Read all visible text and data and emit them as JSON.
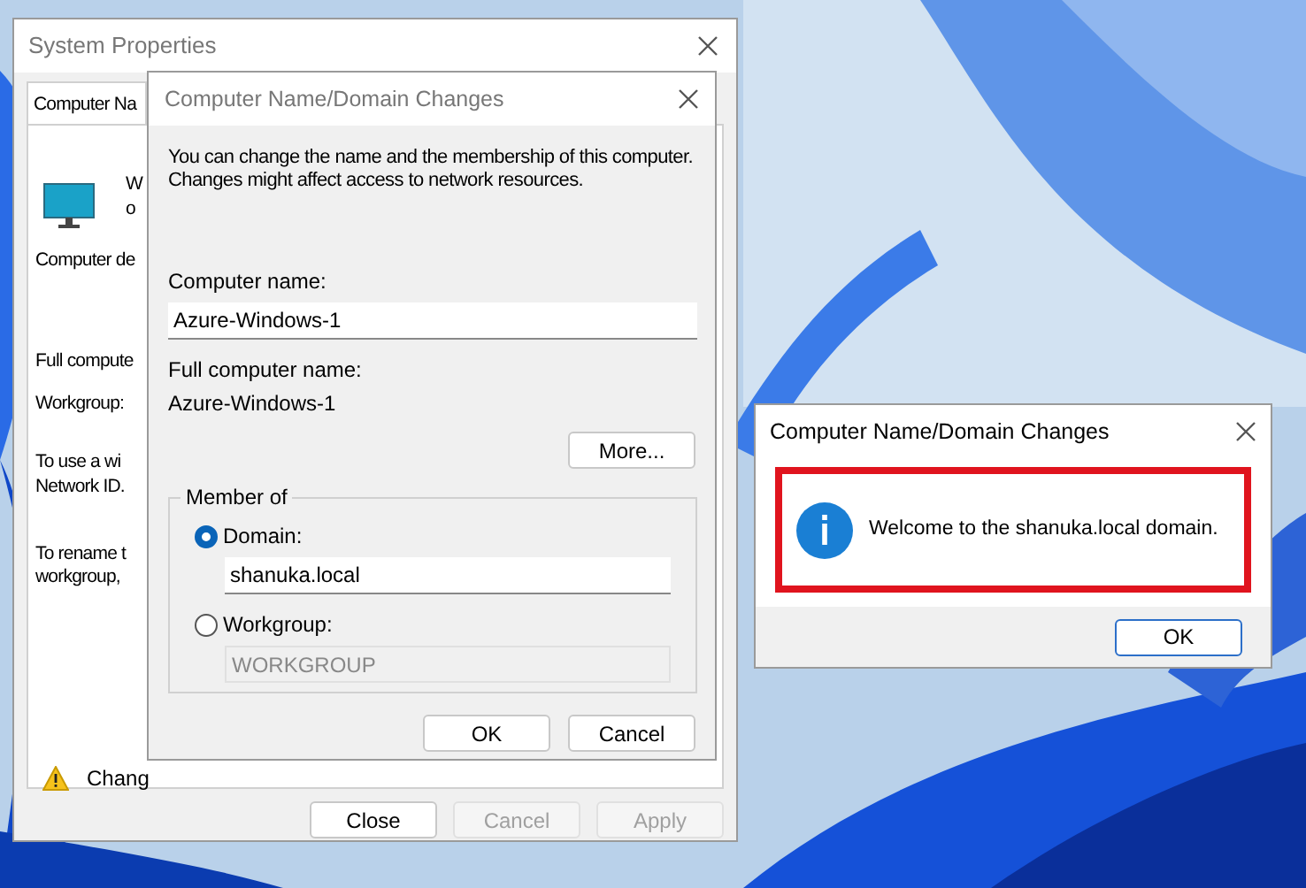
{
  "system_properties": {
    "title": "System Properties",
    "tab": {
      "label": "Computer Na",
      "selected": true
    },
    "fragments": [
      "W",
      "o",
      "Computer de",
      "Full compute",
      "Workgroup:",
      "To use a wi",
      "Network ID.",
      "To rename t",
      "workgroup, "
    ],
    "warning_text": "Chang",
    "buttons": [
      {
        "label": "Close",
        "disabled": false
      },
      {
        "label": "Cancel",
        "disabled": true
      },
      {
        "label": "Apply",
        "disabled": true
      }
    ]
  },
  "domain_dialog": {
    "title": "Computer Name/Domain Changes",
    "description": "You can change the name and the membership of this computer. Changes might affect access to network resources.",
    "computer_name_label": "Computer name:",
    "computer_name": "Azure-Windows-1",
    "full_name_label": "Full computer name:",
    "full_name": "Azure-Windows-1",
    "more_button": "More...",
    "member_of": {
      "label": "Member of",
      "options": [
        {
          "label": "Domain:",
          "selected": true,
          "value": "shanuka.local",
          "disabled": false
        },
        {
          "label": "Workgroup:",
          "selected": false,
          "value": "WORKGROUP",
          "disabled": true
        }
      ]
    },
    "buttons": [
      {
        "label": "OK",
        "disabled": false
      },
      {
        "label": "Cancel",
        "disabled": false
      }
    ]
  },
  "message_box": {
    "title": "Computer Name/Domain Changes",
    "message": "Welcome to the shanuka.local domain.",
    "highlighted": true,
    "button": "OK"
  }
}
